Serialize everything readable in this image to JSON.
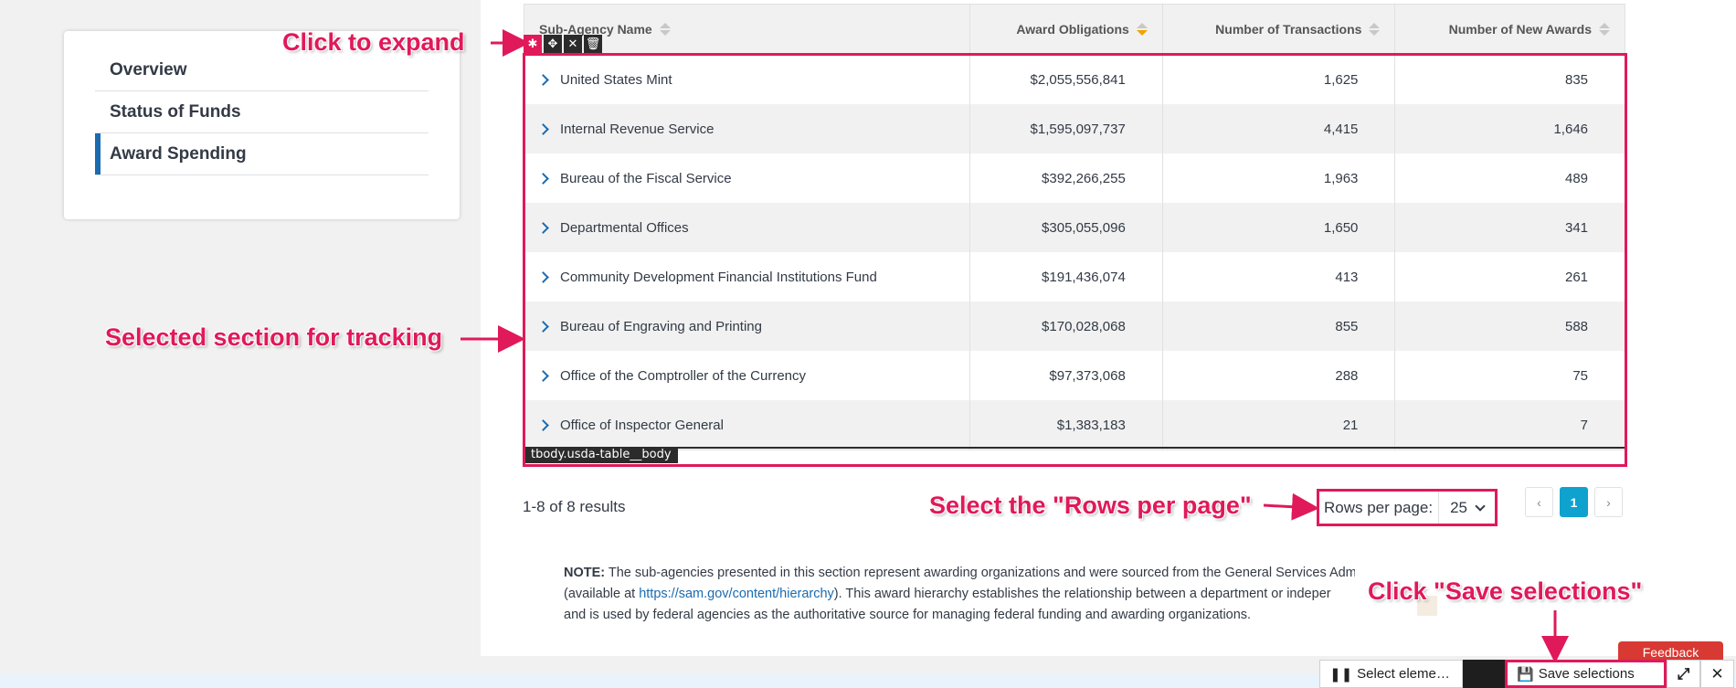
{
  "nav": {
    "items": [
      {
        "label": "Overview",
        "active": false
      },
      {
        "label": "Status of Funds",
        "active": false
      },
      {
        "label": "Award Spending",
        "active": true
      }
    ]
  },
  "table": {
    "headers": [
      "Sub-Agency Name",
      "Award Obligations",
      "Number of Transactions",
      "Number of New Awards"
    ],
    "rows": [
      [
        "United States Mint",
        "$2,055,556,841",
        "1,625",
        "835"
      ],
      [
        "Internal Revenue Service",
        "$1,595,097,737",
        "4,415",
        "1,646"
      ],
      [
        "Bureau of the Fiscal Service",
        "$392,266,255",
        "1,963",
        "489"
      ],
      [
        "Departmental Offices",
        "$305,055,096",
        "1,650",
        "341"
      ],
      [
        "Community Development Financial Institutions Fund",
        "$191,436,074",
        "413",
        "261"
      ],
      [
        "Bureau of Engraving and Printing",
        "$170,028,068",
        "855",
        "588"
      ],
      [
        "Office of the Comptroller of the Currency",
        "$97,373,068",
        "288",
        "75"
      ],
      [
        "Office of Inspector General",
        "$1,383,183",
        "21",
        "7"
      ]
    ],
    "tag": "tbody.usda-table__body"
  },
  "pagination": {
    "results": "1-8 of 8 results",
    "rows_label": "Rows per page:",
    "rows_value": "25",
    "prev": "‹",
    "current": "1",
    "next": "›"
  },
  "note": {
    "label": "NOTE:",
    "line1": " The sub-agencies presented in this section represent awarding organizations and were sourced from the General Services Adm",
    "line2_pre": "(available at ",
    "link": "https://sam.gov/content/hierarchy",
    "line2_post": "). This award hierarchy establishes the relationship between a department or indeper",
    "line3": "and is used by federal agencies as the authoritative source for managing federal funding and awarding organizations."
  },
  "annotations": {
    "expand": "Click to expand",
    "selected": "Selected section for tracking",
    "rows": "Select the \"Rows per page\"",
    "save": "Click \"Save selections\""
  },
  "toolbar": {
    "select_element": "Select eleme…",
    "save": "Save selections",
    "expand_icon": "⤢",
    "close_icon": "✕"
  },
  "feedback": "Feedback",
  "colors": {
    "accent": "#e0195a",
    "link": "#1a6bb0",
    "page_active": "#0fa2cf",
    "sort_active": "#f0a500"
  }
}
